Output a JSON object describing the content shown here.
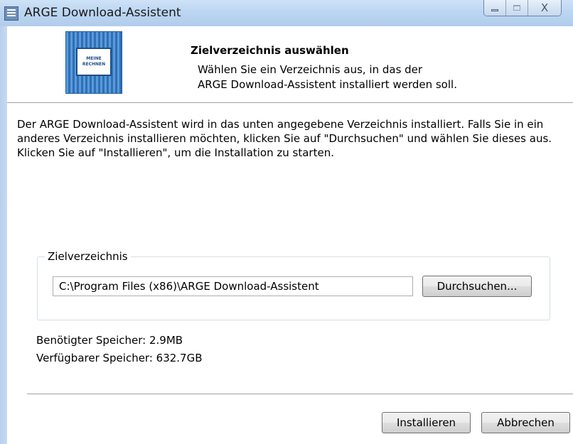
{
  "window": {
    "title": "ARGE Download-Assistent",
    "close_glyph": "X"
  },
  "header": {
    "title": "Zielverzeichnis auswählen",
    "subtitle_line1": "Wählen Sie ein Verzeichnis aus, in das der",
    "subtitle_line2": "ARGE Download-Assistent installiert werden soll.",
    "logo_text_line1": "MEINE",
    "logo_text_line2": "RECHNEN"
  },
  "content": {
    "intro_text": "Der ARGE Download-Assistent wird in das unten angegebene Verzeichnis installiert. Falls Sie in ein anderes Verzeichnis installieren möchten, klicken Sie auf \"Durchsuchen\" und wählen Sie dieses aus. Klicken Sie auf \"Installieren\", um die Installation zu starten.",
    "destination": {
      "group_label": "Zielverzeichnis",
      "path_value": "C:\\Program Files (x86)\\ARGE Download-Assistent",
      "browse_label": "Durchsuchen..."
    },
    "space_required": "Benötigter Speicher: 2.9MB",
    "space_available": "Verfügbarer Speicher: 632.7GB"
  },
  "footer": {
    "install_label": "Installieren",
    "cancel_label": "Abbrechen"
  },
  "colors": {
    "titlebar": "#bcd6f2",
    "logo_blue": "#2e6fb8"
  }
}
